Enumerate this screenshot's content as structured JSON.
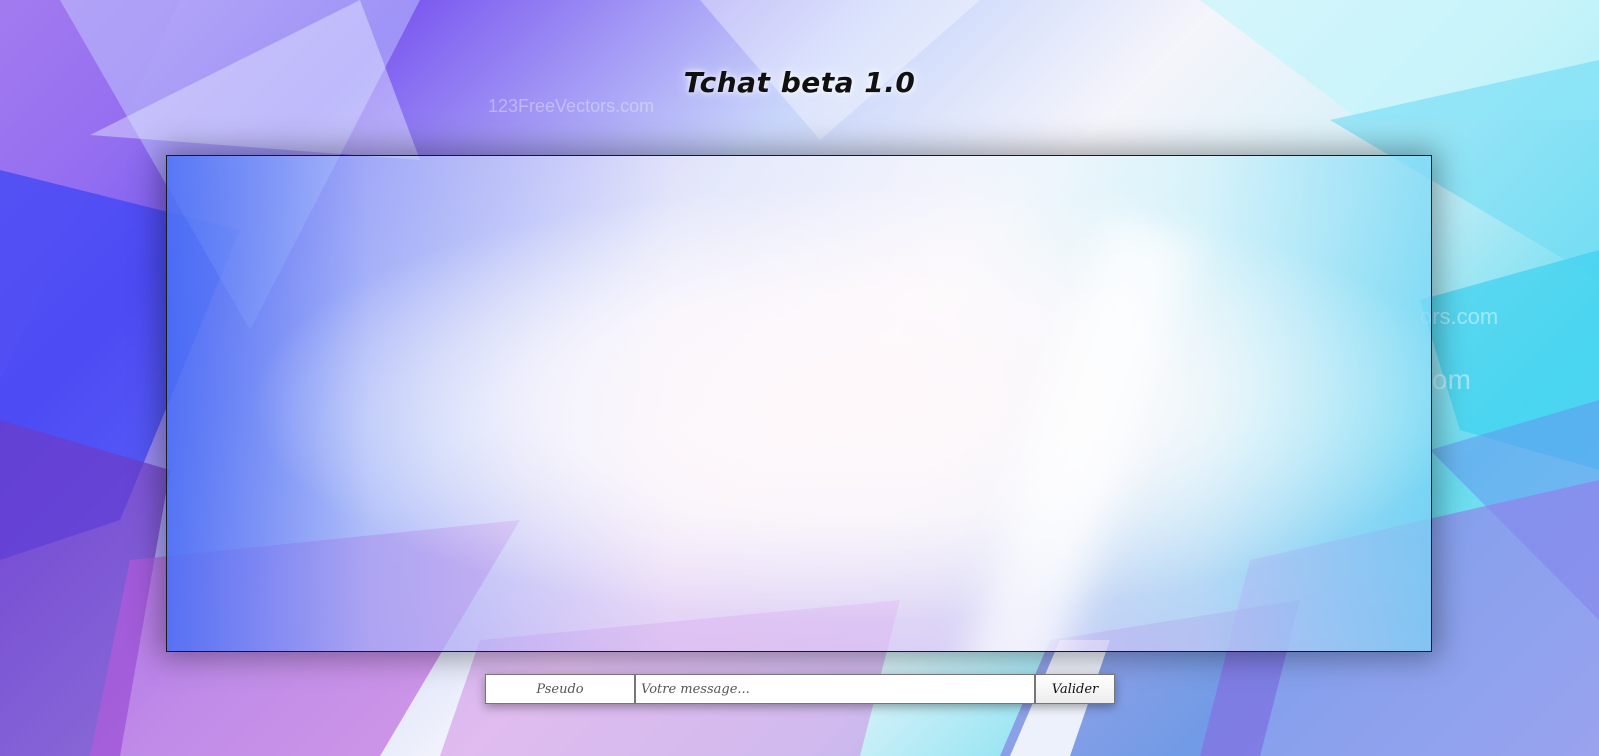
{
  "page": {
    "title": "Tchat beta 1.0"
  },
  "background": {
    "watermark_1": "123FreeVectors.com",
    "watermark_2": "ors.com",
    "watermark_3": "om"
  },
  "chat": {
    "messages": []
  },
  "form": {
    "pseudo_placeholder": "Pseudo",
    "message_placeholder": "Votre message...",
    "submit_label": "Valider"
  },
  "colors": {
    "accent_purple": "#7d5cf0",
    "accent_cyan": "#45d8f0",
    "title_text": "#111111",
    "panel_border": "#1a1a1a"
  }
}
